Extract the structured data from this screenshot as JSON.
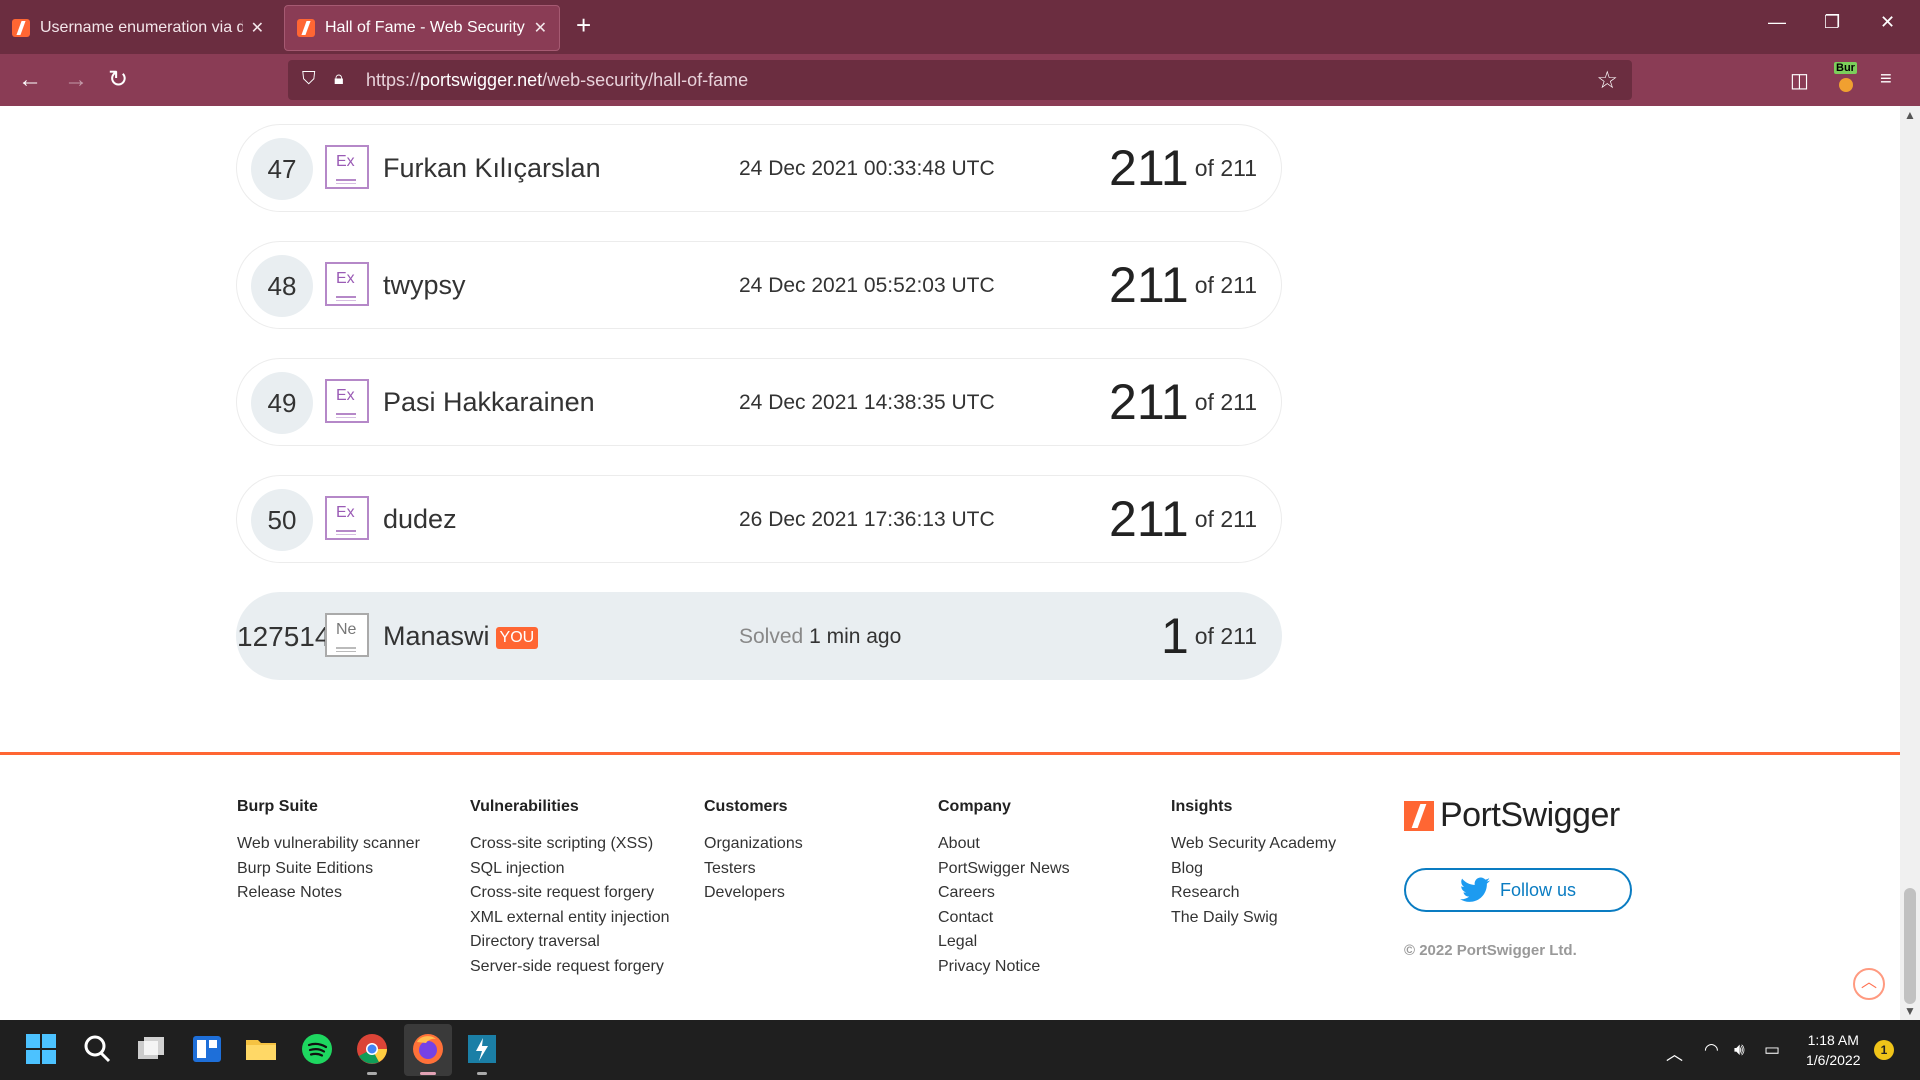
{
  "browser": {
    "tabs": [
      {
        "title": "Username enumeration via diffe",
        "active": false
      },
      {
        "title": "Hall of Fame - Web Security Ac",
        "active": true
      }
    ],
    "url_scheme": "https://",
    "url_domain": "portswigger.net",
    "url_path": "/web-security/hall-of-fame",
    "extension_label": "Bur"
  },
  "leaderboard": [
    {
      "rank": "47",
      "badge": "Ex",
      "name": "Furkan Kılıçarslan",
      "date": "24 Dec 2021 00:33:48 UTC",
      "score": "211",
      "of": "of 211"
    },
    {
      "rank": "48",
      "badge": "Ex",
      "name": "twypsy",
      "date": "24 Dec 2021 05:52:03 UTC",
      "score": "211",
      "of": "of 211"
    },
    {
      "rank": "49",
      "badge": "Ex",
      "name": "Pasi Hakkarainen",
      "date": "24 Dec 2021 14:38:35 UTC",
      "score": "211",
      "of": "of 211"
    },
    {
      "rank": "50",
      "badge": "Ex",
      "name": "dudez",
      "date": "26 Dec 2021 17:36:13 UTC",
      "score": "211",
      "of": "of 211"
    }
  ],
  "me": {
    "rank": "127514",
    "badge": "Ne",
    "name": "Manaswi",
    "you_tag": "YOU",
    "solved_label": "Solved",
    "solved_time": "1 min ago",
    "score": "1",
    "of": "of 211"
  },
  "footer": {
    "columns": [
      {
        "heading": "Burp Suite",
        "links": [
          "Web vulnerability scanner",
          "Burp Suite Editions",
          "Release Notes"
        ]
      },
      {
        "heading": "Vulnerabilities",
        "links": [
          "Cross-site scripting (XSS)",
          "SQL injection",
          "Cross-site request forgery",
          "XML external entity injection",
          "Directory traversal",
          "Server-side request forgery"
        ]
      },
      {
        "heading": "Customers",
        "links": [
          "Organizations",
          "Testers",
          "Developers"
        ]
      },
      {
        "heading": "Company",
        "links": [
          "About",
          "PortSwigger News",
          "Careers",
          "Contact",
          "Legal",
          "Privacy Notice"
        ]
      },
      {
        "heading": "Insights",
        "links": [
          "Web Security Academy",
          "Blog",
          "Research",
          "The Daily Swig"
        ]
      }
    ],
    "brand": "PortSwigger",
    "follow_label": "Follow us",
    "copyright": "© 2022 PortSwigger Ltd."
  },
  "taskbar": {
    "time": "1:18 AM",
    "date": "1/6/2022",
    "notifications": "1"
  },
  "colors": {
    "accent": "#ff6633",
    "tab_bar": "#6b2d40",
    "toolbar": "#8a3c55",
    "twitter_blue": "#0a7cc2",
    "badge_purple": "#b588c8"
  }
}
